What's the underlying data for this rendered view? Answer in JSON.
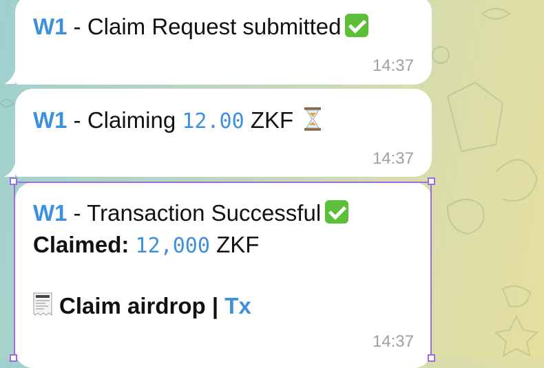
{
  "messages": [
    {
      "sender": "W1",
      "separator": " - ",
      "text": "Claim Request submitted",
      "status_icon": "check-mark-icon",
      "time": "14:37"
    },
    {
      "sender": "W1",
      "separator": " - ",
      "prefix": "Claiming ",
      "amount": "12.00",
      "unit": " ZKF",
      "status_icon": "hourglass-icon",
      "time": "14:37"
    },
    {
      "sender": "W1",
      "separator": " - ",
      "text": "Transaction Successful",
      "status_icon": "check-mark-icon",
      "claimed_label": "Claimed:",
      "claimed_amount": "12,000",
      "claimed_unit": " ZKF",
      "link_icon": "receipt-icon",
      "link_text": "Claim airdrop | ",
      "link_tx": "Tx",
      "time": "14:37"
    }
  ],
  "colors": {
    "accent": "#3d8fe0",
    "selection": "#9a6ee0",
    "check": "#5bbf3a"
  }
}
